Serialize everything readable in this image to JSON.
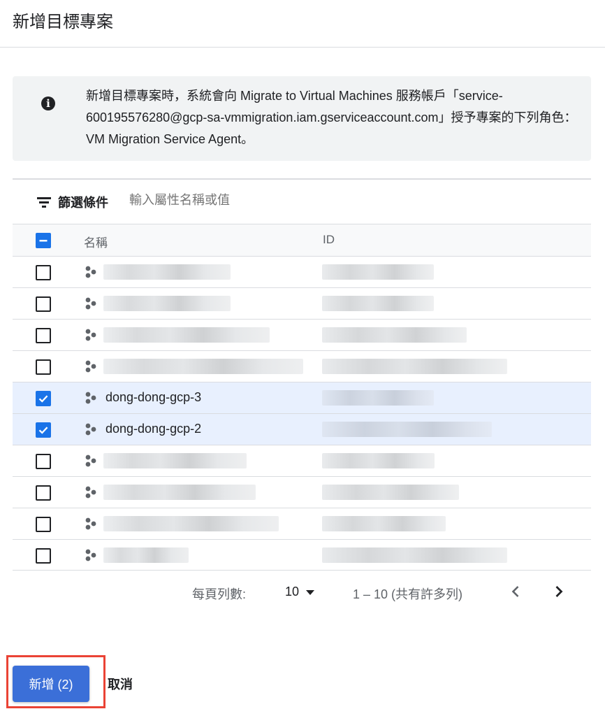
{
  "dialog": {
    "title": "新增目標專案"
  },
  "info_banner": {
    "icon": "info-icon",
    "icon_glyph": "i",
    "text": "新增目標專案時，系統會向 Migrate to Virtual Machines 服務帳戶「service-600195576280@gcp-sa-vmmigration.iam.gserviceaccount.com」授予專案的下列角色：VM Migration Service Agent。"
  },
  "filter": {
    "label": "篩選條件",
    "placeholder": "輸入屬性名稱或值"
  },
  "table": {
    "columns": [
      "名稱",
      "ID"
    ],
    "header_checkbox_state": "indeterminate",
    "rows": [
      {
        "checked": false,
        "name": "",
        "name_redacted": true,
        "id_redacted": true
      },
      {
        "checked": false,
        "name": "",
        "name_redacted": true,
        "id_redacted": true
      },
      {
        "checked": false,
        "name": "",
        "name_redacted": true,
        "id_redacted": true
      },
      {
        "checked": false,
        "name": "",
        "name_redacted": true,
        "id_redacted": true
      },
      {
        "checked": true,
        "name": "dong-dong-gcp-3",
        "name_redacted": false,
        "id_redacted": true
      },
      {
        "checked": true,
        "name": "dong-dong-gcp-2",
        "name_redacted": false,
        "id_redacted": true
      },
      {
        "checked": false,
        "name": "",
        "name_redacted": true,
        "id_redacted": true
      },
      {
        "checked": false,
        "name": "",
        "name_redacted": true,
        "id_redacted": true
      },
      {
        "checked": false,
        "name": "",
        "name_redacted": true,
        "id_redacted": true
      },
      {
        "checked": false,
        "name": "",
        "name_redacted": true,
        "id_redacted": true
      }
    ]
  },
  "pagination": {
    "rows_per_page_label": "每頁列數:",
    "rows_per_page_value": "10",
    "range_text": "1 – 10 (共有許多列)",
    "prev_icon": "chevron-left-icon",
    "next_icon": "chevron-right-icon"
  },
  "actions": {
    "add_label": "新增 (2)",
    "cancel_label": "取消"
  },
  "colors": {
    "primary": "#1a73e8",
    "add_button": "#3b6fd8",
    "selected_row": "#e8f0fe",
    "highlight_border": "#ea4335",
    "info_background": "#f1f3f4"
  }
}
